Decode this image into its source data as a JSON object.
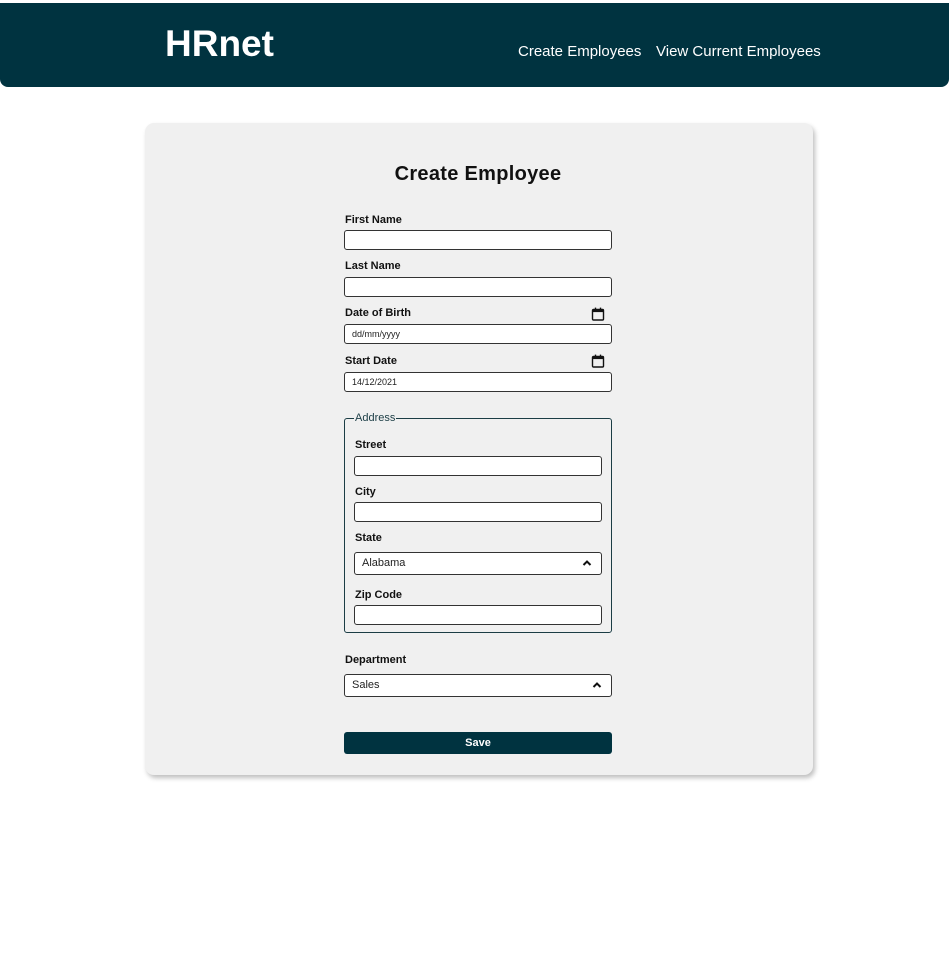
{
  "header": {
    "logo": "HRnet",
    "nav": {
      "create": "Create Employees",
      "view": "View Current Employees"
    }
  },
  "form": {
    "title": "Create Employee",
    "first_name": {
      "label": "First Name",
      "value": ""
    },
    "last_name": {
      "label": "Last Name",
      "value": ""
    },
    "date_of_birth": {
      "label": "Date of Birth",
      "value": "dd/mm/yyyy",
      "icon": "calendar-icon"
    },
    "start_date": {
      "label": "Start Date",
      "value": "14/12/2021",
      "icon": "calendar-icon"
    },
    "address": {
      "legend": "Address",
      "street": {
        "label": "Street",
        "value": ""
      },
      "city": {
        "label": "City",
        "value": ""
      },
      "state": {
        "label": "State",
        "value": "Alabama",
        "icon": "chevron-up-icon"
      },
      "zip": {
        "label": "Zip Code",
        "value": ""
      }
    },
    "department": {
      "label": "Department",
      "value": "Sales",
      "icon": "chevron-up-icon"
    },
    "save_label": "Save"
  },
  "colors": {
    "primary": "#003340",
    "card_bg": "#f0f0f0",
    "fieldset_border": "#1b3d45"
  }
}
